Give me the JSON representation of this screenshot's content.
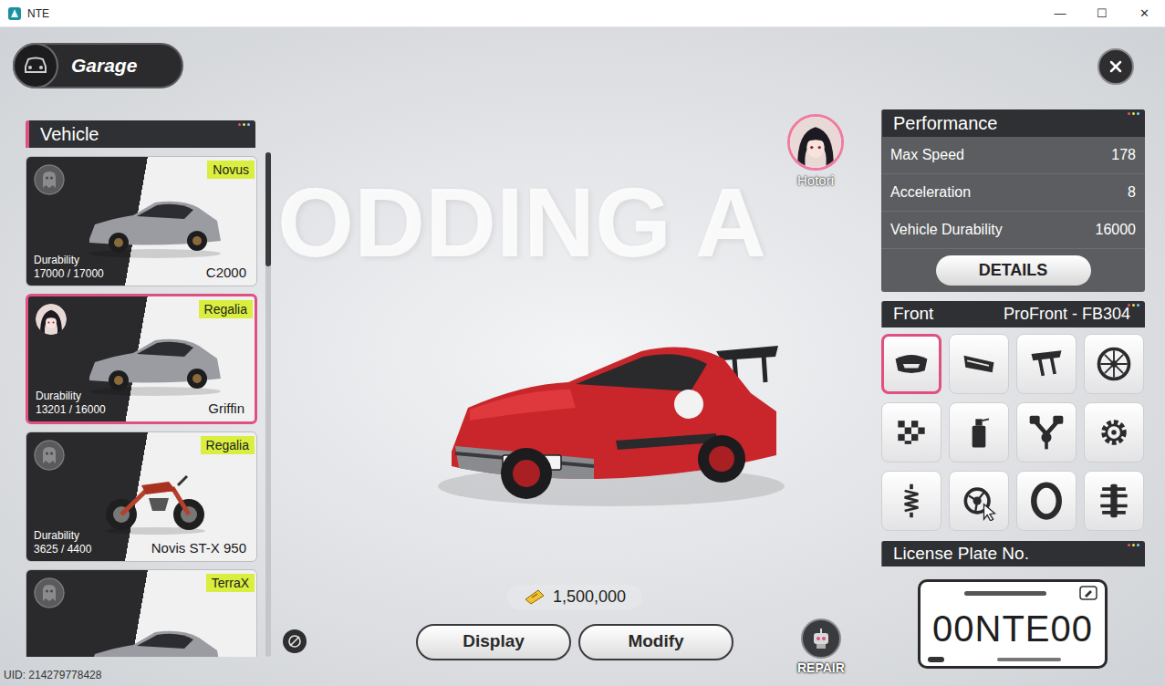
{
  "window": {
    "title": "NTE",
    "controls": [
      "—",
      "☐",
      "✕"
    ]
  },
  "header": {
    "title": "Garage"
  },
  "vehicle_panel": {
    "title": "Vehicle",
    "vehicles": [
      {
        "brand": "Novus",
        "name": "C2000",
        "durability_label": "Durability",
        "durability": "17000 / 17000",
        "kind": "car",
        "driver": false,
        "selected": false
      },
      {
        "brand": "Regalia",
        "name": "Griffin",
        "durability_label": "Durability",
        "durability": "13201 / 16000",
        "kind": "car",
        "driver": true,
        "selected": true
      },
      {
        "brand": "Regalia",
        "name": "Novis ST-X 950",
        "durability_label": "Durability",
        "durability": "3625 / 4400",
        "kind": "motorcycle",
        "driver": false,
        "selected": false
      },
      {
        "brand": "TerraX",
        "kind": "car",
        "driver": false,
        "selected": false
      }
    ]
  },
  "watermark": "ODDING A",
  "driver": {
    "name": "Hotori"
  },
  "currency": {
    "amount": "1,500,000"
  },
  "actions": [
    "Display",
    "Modify"
  ],
  "repair": {
    "label": "REPAIR"
  },
  "performance": {
    "title": "Performance",
    "stats": [
      {
        "label": "Max Speed",
        "value": "178"
      },
      {
        "label": "Acceleration",
        "value": "8"
      },
      {
        "label": "Vehicle Durability",
        "value": "16000"
      }
    ],
    "details_button": "DETAILS"
  },
  "parts": {
    "category": "Front",
    "part_name": "ProFront - FB304",
    "slots": [
      {
        "kind": "front-bumper",
        "selected": true
      },
      {
        "kind": "rear-bumper",
        "selected": false
      },
      {
        "kind": "spoiler",
        "selected": false
      },
      {
        "kind": "rim",
        "selected": false
      },
      {
        "kind": "livery",
        "selected": false
      },
      {
        "kind": "paint",
        "selected": false
      },
      {
        "kind": "engine",
        "selected": false
      },
      {
        "kind": "transmission",
        "selected": false
      },
      {
        "kind": "suspension",
        "selected": false
      },
      {
        "kind": "turbo",
        "selected": false
      },
      {
        "kind": "tire",
        "selected": false
      },
      {
        "kind": "drivetrain",
        "selected": false
      }
    ]
  },
  "license": {
    "title": "License Plate No.",
    "plate": "00NTE00"
  },
  "uid": "UID: 214279778428"
}
